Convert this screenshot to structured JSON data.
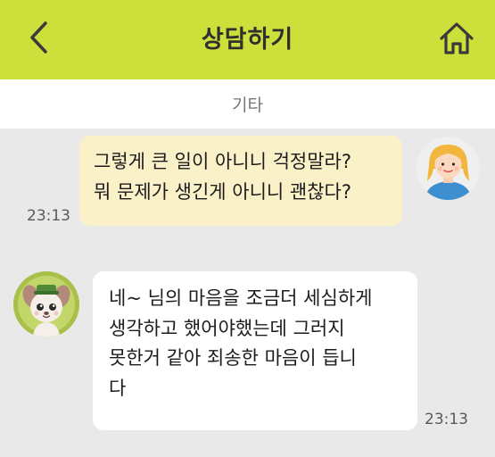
{
  "header": {
    "title": "상담하기",
    "back_icon": "chevron-left-icon",
    "home_icon": "home-icon",
    "bg_color": "#cddf3a"
  },
  "category": {
    "label": "기타"
  },
  "messages": [
    {
      "sender": "me",
      "lines": [
        "그렇게 큰 일이 아니니 걱정말라?",
        "뭐 문제가 생긴게 아니니 괜찮다?"
      ],
      "time": "23:13",
      "bubble_color": "#fbf1c9"
    },
    {
      "sender": "other",
      "lines": [
        "네~ 님의 마음을 조금더 세심하게",
        "생각하고 했어야했는데 그러지",
        "못한거 같아 죄송한 마음이 듭니",
        "다"
      ],
      "time": "23:13",
      "bubble_color": "#ffffff"
    }
  ]
}
